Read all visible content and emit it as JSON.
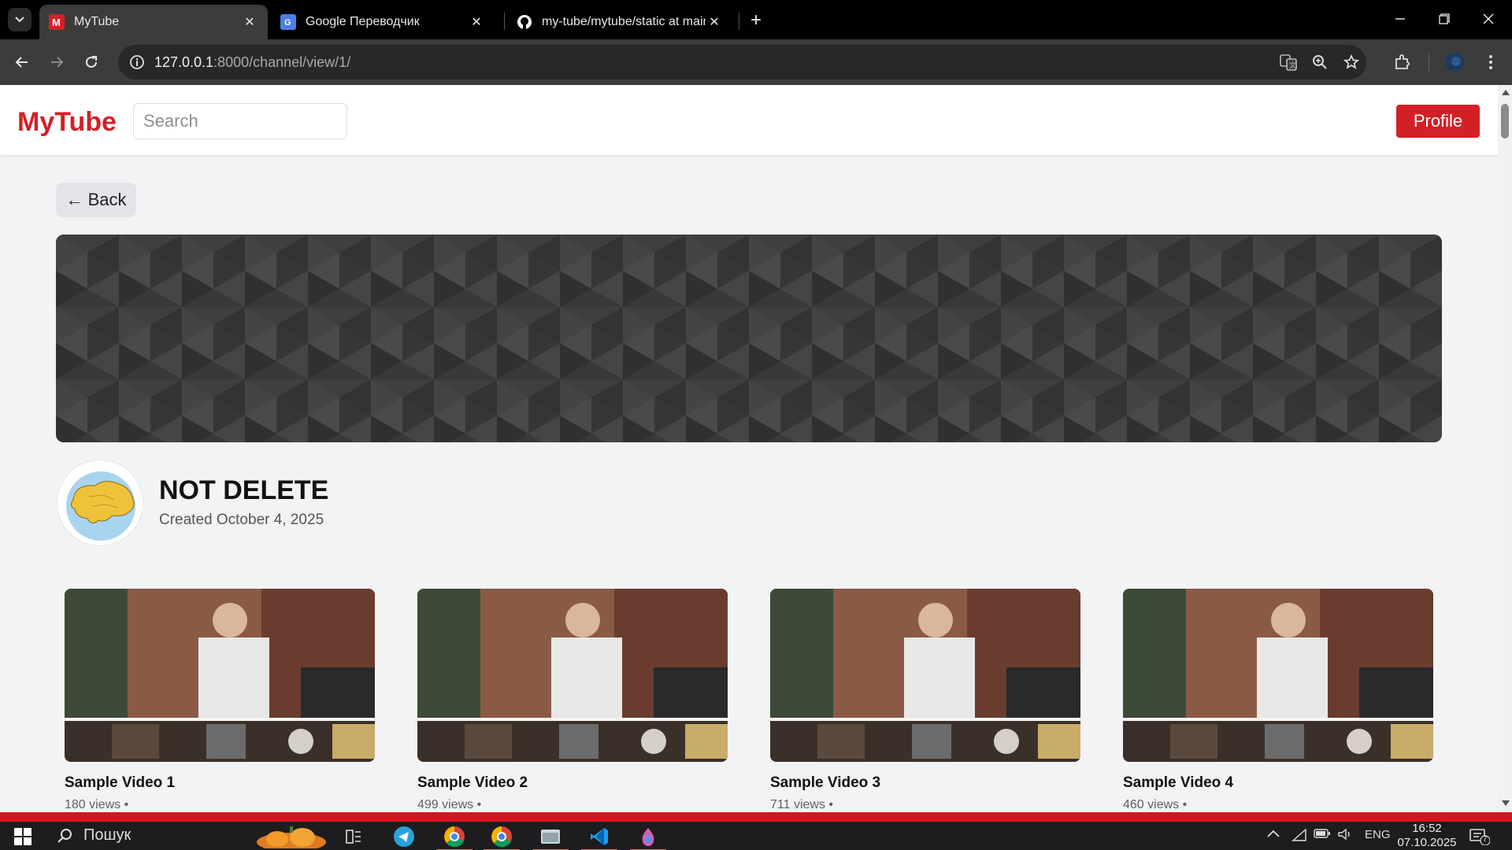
{
  "browser": {
    "tabs": [
      {
        "title": "MyTube",
        "active": true
      },
      {
        "title": "Google Переводчик",
        "active": false
      },
      {
        "title": "my-tube/mytube/static at main",
        "active": false
      }
    ],
    "url_host": "127.0.0.1",
    "url_rest": ":8000/channel/view/1/"
  },
  "site": {
    "logo": "MyTube",
    "search_placeholder": "Search",
    "profile_label": "Profile",
    "back_label": "← Back",
    "accent_color": "#d32027"
  },
  "channel": {
    "name": "NOT DELETE",
    "created": "Created October 4, 2025"
  },
  "videos": [
    {
      "title": "Sample Video 1",
      "meta": "180 views •"
    },
    {
      "title": "Sample Video 2",
      "meta": "499 views •"
    },
    {
      "title": "Sample Video 3",
      "meta": "711 views •"
    },
    {
      "title": "Sample Video 4",
      "meta": "460 views •"
    }
  ],
  "taskbar": {
    "search_label": "Пошук",
    "language": "ENG",
    "time": "16:52",
    "date": "07.10.2025",
    "notifications": "7"
  }
}
